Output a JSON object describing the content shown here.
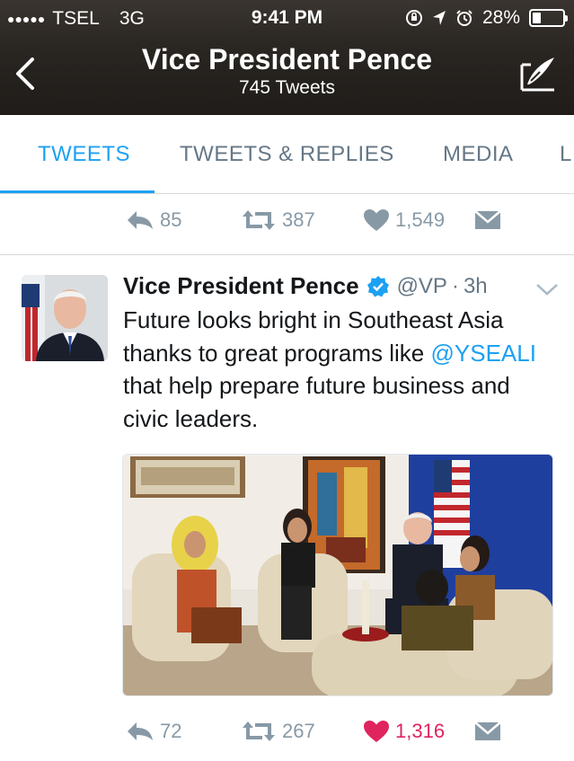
{
  "status_bar": {
    "signal": "●●●●●",
    "carrier": "TSEL",
    "network": "3G",
    "time": "9:41 PM",
    "battery": "28%",
    "battery_level": 0.28
  },
  "header": {
    "title": "Vice President Pence",
    "subtitle": "745 Tweets"
  },
  "tabs": [
    {
      "label": "TWEETS",
      "active": true
    },
    {
      "label": "TWEETS & REPLIES",
      "active": false
    },
    {
      "label": "MEDIA",
      "active": false
    },
    {
      "label": "L",
      "active": false
    }
  ],
  "prev_tweet_actions": {
    "replies": "85",
    "retweets": "387",
    "likes": "1,549"
  },
  "tweet": {
    "name": "Vice President Pence",
    "handle": "@VP",
    "separator": "·",
    "time": "3h",
    "text_before": "Future looks bright in Southeast Asia thanks to great programs like ",
    "mention": "@YSEALI",
    "text_after": " that help prepare future business and civic leaders.",
    "actions": {
      "replies": "72",
      "retweets": "267",
      "likes": "1,316"
    }
  },
  "colors": {
    "accent": "#1da1f2",
    "like": "#e0245e",
    "muted": "#8899a6"
  }
}
